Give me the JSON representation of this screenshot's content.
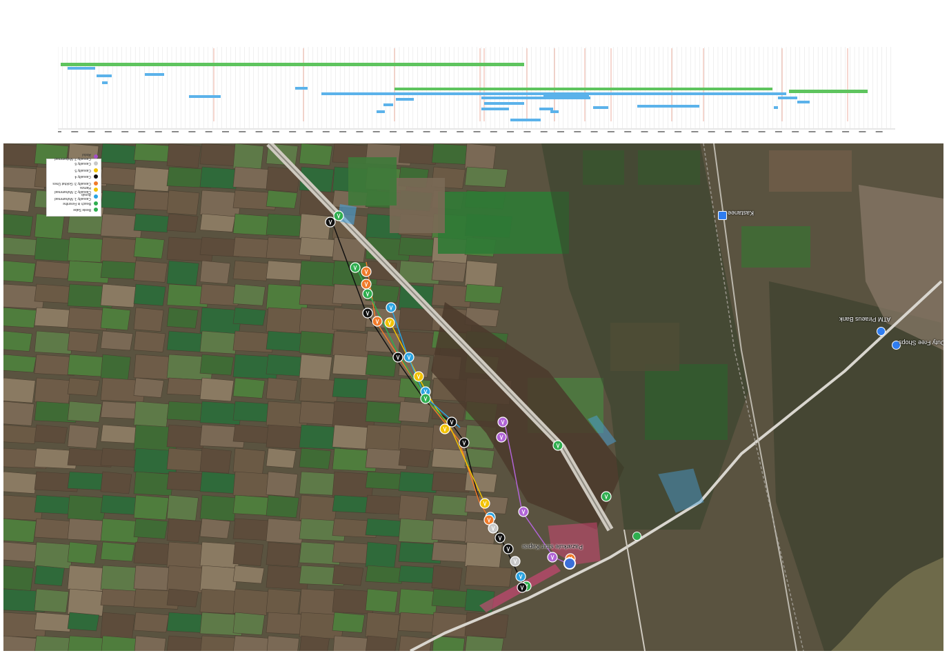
{
  "timeline": {
    "grid_color": "#d8d8d8",
    "marker_color": "#e07a60",
    "bar_colors": {
      "green": "#5ec45e",
      "blue": "#5bb2ea"
    }
  },
  "map": {
    "labels": {
      "kastanee": "Kastanee",
      "bank": "ATM Piraeus Bank",
      "duty_free": "Hellenic Duty Free Shops",
      "pazarkule": "Pazarkule sınır Kapısı"
    },
    "legend": [
      {
        "label": "Beste Sabe",
        "color": "#2fae4f"
      },
      {
        "label": "Beach in Ferenthe",
        "color": "#2fae4f"
      },
      {
        "label": "Casualty 1: Muhammad Ayoub",
        "color": "#2aa3e0"
      },
      {
        "label": "Casualty 2: Muhammad Hamza",
        "color": "#f2c200"
      },
      {
        "label": "Casualty 3: Gokhat Ünes",
        "color": "#f07a2a"
      },
      {
        "label": "Casualty 4",
        "color": "#111111"
      },
      {
        "label": "Casualty 5",
        "color": "#f2c200"
      },
      {
        "label": "Casualty 6",
        "color": "#c8c8c8"
      },
      {
        "label": "Casualty 7: Muhammad Abdul",
        "color": "#a64fc7"
      }
    ],
    "route_colors": {
      "black": "#111111",
      "orange": "#f07a2a",
      "yellow": "#f2c200",
      "green": "#2fae4f",
      "blue": "#2aa3e0",
      "purple": "#b164d6"
    },
    "zone_colors": {
      "pink": "#e6447f",
      "blue": "#4aa3dc"
    },
    "icons": [
      "person-icon",
      "bank-icon",
      "duty-free-icon",
      "exit-icon",
      "gate-icon"
    ]
  }
}
